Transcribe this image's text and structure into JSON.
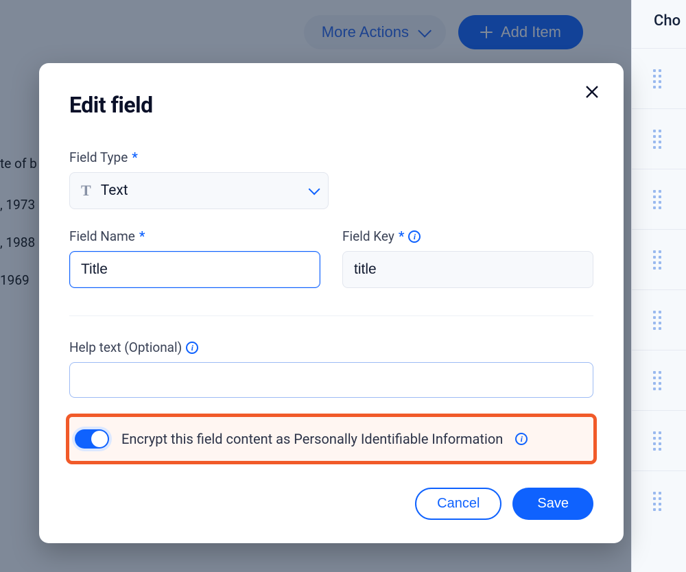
{
  "header": {
    "more_actions_label": "More Actions",
    "add_item_label": "Add Item"
  },
  "side": {
    "header": "Cho",
    "row_count": 8
  },
  "bg_rows": {
    "r0": "te of b",
    "r1": ", 1973",
    "r2": ", 1988",
    "r3": "1969 "
  },
  "modal": {
    "title": "Edit field",
    "field_type": {
      "label": "Field Type",
      "value": "Text"
    },
    "field_name": {
      "label": "Field Name",
      "value": "Title"
    },
    "field_key": {
      "label": "Field Key",
      "value": "title"
    },
    "help_text": {
      "label": "Help text (Optional)",
      "value": ""
    },
    "encrypt": {
      "label": "Encrypt this field content as Personally Identifiable Information",
      "on": true
    },
    "buttons": {
      "cancel": "Cancel",
      "save": "Save"
    }
  }
}
